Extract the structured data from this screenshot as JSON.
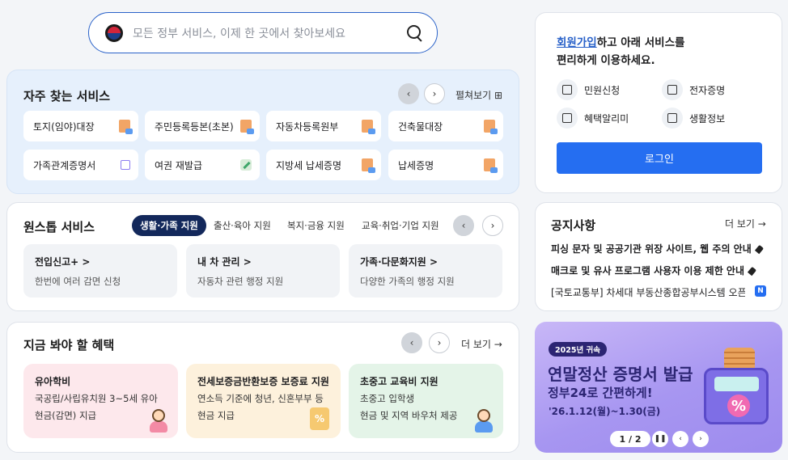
{
  "search": {
    "placeholder": "모든 정부 서비스, 이제 한 곳에서 찾아보세요"
  },
  "frequent": {
    "title": "자주 찾는 서비스",
    "expand_label": "펼쳐보기 ⊞",
    "tiles": [
      {
        "label": "토지(임야)대장",
        "icon": "document-icon"
      },
      {
        "label": "주민등록등본(초본)",
        "icon": "document-icon"
      },
      {
        "label": "자동차등록원부",
        "icon": "document-icon"
      },
      {
        "label": "건축물대장",
        "icon": "document-icon"
      },
      {
        "label": "가족관계증명서",
        "icon": "external-link-icon"
      },
      {
        "label": "여권 재발급",
        "icon": "pen-icon"
      },
      {
        "label": "지방세 납세증명",
        "icon": "document-icon"
      },
      {
        "label": "납세증명",
        "icon": "document-icon"
      }
    ]
  },
  "onestop": {
    "title": "원스톱 서비스",
    "tabs": [
      "생활·가족 지원",
      "출산·육아 지원",
      "복지·금융 지원",
      "교육·취업·기업 지원"
    ],
    "boxes": [
      {
        "title": "전입신고+ >",
        "desc": "한번에 여러 감면 신청"
      },
      {
        "title": "내 차 관리 >",
        "desc": "자동차 관련 행정 지원"
      },
      {
        "title": "가족·다문화지원 >",
        "desc": "다양한 가족의 행정 지원"
      }
    ]
  },
  "benefits": {
    "title": "지금 봐야 할 혜택",
    "more_label": "더 보기 →",
    "items": [
      {
        "title": "유아학비",
        "line1": "국공립/사립유치원 3~5세 유아",
        "line2": "현금(감면) 지급"
      },
      {
        "title": "전세보증금반환보증 보증료 지원",
        "line1": "연소득 기준에 청년, 신혼부부 등",
        "line2": "현금 지급"
      },
      {
        "title": "초중고 교육비 지원",
        "line1": "초중고 입학생",
        "line2": "현금 및 지역 바우처 제공"
      }
    ]
  },
  "login": {
    "link_text": "회원가입",
    "text_rest": "하고 아래 서비스를",
    "text_line2": "편리하게 이용하세요.",
    "services": [
      "민원신청",
      "전자증명",
      "혜택알리미",
      "생활정보"
    ],
    "button_label": "로그인",
    "accent": "#256ef1"
  },
  "notice": {
    "title": "공지사항",
    "more_label": "더 보기 →",
    "items": [
      "피싱 문자 및 공공기관 위장 사이트, 웹 주의 안내",
      "매크로 및 유사 프로그램 사용자 이용 제한 안내",
      "[국토교통부] 차세대 부동산종합공부시스템 오픈…"
    ],
    "new_badge": "N"
  },
  "banner": {
    "pill": "2025년 귀속",
    "title": "연말정산 증명서 발급",
    "subtitle": "정부24로 간편하게!",
    "date": "'26.1.12(월)~1.30(금)",
    "pager": "1 / 2"
  }
}
